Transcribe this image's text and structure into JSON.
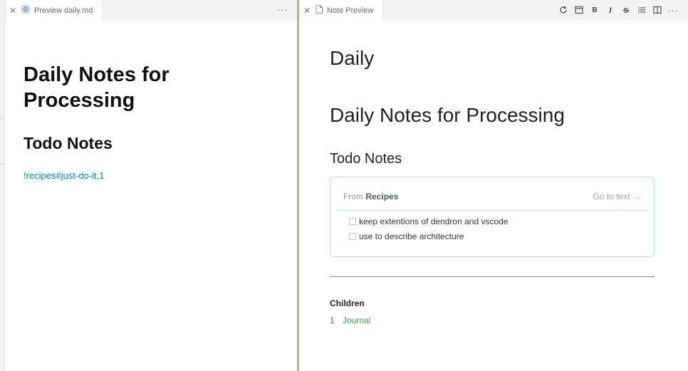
{
  "left_tab": {
    "title": "Preview daily.md",
    "close_glyph": "✕",
    "more_glyph": "···"
  },
  "right_tab": {
    "title": "Note Preview",
    "close_glyph": "✕"
  },
  "toolbar": {
    "icons": [
      "refresh-icon",
      "layout-icon",
      "bold-icon",
      "italic-icon",
      "strikethrough-icon",
      "list-icon",
      "split-editor-icon"
    ],
    "bold_glyph": "B",
    "italic_glyph": "I",
    "more_glyph": "···"
  },
  "left_doc": {
    "heading": "Daily Notes for Processing",
    "subheading": "Todo Notes",
    "link": "!recipes#just-do-it,1"
  },
  "right_doc": {
    "title": "Daily",
    "heading": "Daily Notes for Processing",
    "subheading": "Todo Notes",
    "embed": {
      "from_label": "From",
      "from_note": "Recipes",
      "goto_label": "Go to text →",
      "tasks": [
        {
          "text": "keep extentions of dendron and vscode",
          "checked": false
        },
        {
          "text": "use to describe architecture",
          "checked": false
        }
      ]
    },
    "children": {
      "title": "Children",
      "items": [
        {
          "num": "1",
          "label": "Journal"
        }
      ]
    }
  },
  "colors": {
    "link_blue": "#0a7bc2",
    "child_link_green": "#2ea44f",
    "embed_border": "#b7dbe0"
  }
}
